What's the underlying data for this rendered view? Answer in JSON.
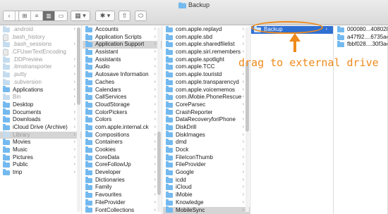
{
  "window": {
    "title": "Backup"
  },
  "toolbar": {
    "back": "‹",
    "forward": "›",
    "view_icons": [
      "⊞",
      "≡",
      "▥",
      "▭"
    ],
    "arrange": "▦ ▾",
    "action": "✱ ▾",
    "share": "⇧",
    "tag": "⬭"
  },
  "columns": [
    {
      "items": [
        {
          "label": ".android",
          "dim": true
        },
        {
          "label": ".bash_history",
          "dim": true,
          "file": true
        },
        {
          "label": ".bash_sessions",
          "dim": true
        },
        {
          "label": ".CFUserTextEncoding",
          "dim": true,
          "file": true
        },
        {
          "label": ".DDPreview",
          "dim": true
        },
        {
          "label": ".itmstransporter",
          "dim": true
        },
        {
          "label": ".putty",
          "dim": true
        },
        {
          "label": ".subversion",
          "dim": true
        },
        {
          "label": "Applications"
        },
        {
          "label": "Bin",
          "dim": true
        },
        {
          "label": "Desktop"
        },
        {
          "label": "Documents"
        },
        {
          "label": "Downloads"
        },
        {
          "label": "iCloud Drive (Archive)"
        },
        {
          "label": "Library",
          "dim": true,
          "selected": true
        },
        {
          "label": "Movies"
        },
        {
          "label": "Music"
        },
        {
          "label": "Pictures"
        },
        {
          "label": "Public"
        },
        {
          "label": "tmp"
        }
      ]
    },
    {
      "items": [
        {
          "label": "Accounts"
        },
        {
          "label": "Application Scripts"
        },
        {
          "label": "Application Support",
          "selected": true
        },
        {
          "label": "Assistant"
        },
        {
          "label": "Assistants"
        },
        {
          "label": "Audio"
        },
        {
          "label": "Autosave Information"
        },
        {
          "label": "Caches"
        },
        {
          "label": "Calendars"
        },
        {
          "label": "CallServices"
        },
        {
          "label": "CloudStorage"
        },
        {
          "label": "ColorPickers"
        },
        {
          "label": "Colors"
        },
        {
          "label": "com.apple.internal.ck"
        },
        {
          "label": "Compositions"
        },
        {
          "label": "Containers"
        },
        {
          "label": "Cookies"
        },
        {
          "label": "CoreData"
        },
        {
          "label": "CoreFollowUp"
        },
        {
          "label": "Developer"
        },
        {
          "label": "Dictionaries"
        },
        {
          "label": "Family"
        },
        {
          "label": "Favourites"
        },
        {
          "label": "FileProvider"
        },
        {
          "label": "FontCollections"
        }
      ]
    },
    {
      "items": [
        {
          "label": "com.apple.replayd"
        },
        {
          "label": "com.apple.sbd"
        },
        {
          "label": "com.apple.sharedfilelist"
        },
        {
          "label": "com.apple.siri.remembers"
        },
        {
          "label": "com.apple.spotlight"
        },
        {
          "label": "com.apple.TCC"
        },
        {
          "label": "com.apple.touristd"
        },
        {
          "label": "com.apple.transparencyd"
        },
        {
          "label": "com.apple.voicememos"
        },
        {
          "label": "com.iMobie.PhoneRescue"
        },
        {
          "label": "CoreParsec"
        },
        {
          "label": "CrashReporter"
        },
        {
          "label": "DataRecoveryforiPhone"
        },
        {
          "label": "DiskDrill"
        },
        {
          "label": "DiskImages"
        },
        {
          "label": "dmd"
        },
        {
          "label": "Dock"
        },
        {
          "label": "FileIconThumb"
        },
        {
          "label": "FileProvider"
        },
        {
          "label": "Google"
        },
        {
          "label": "icdd"
        },
        {
          "label": "iCloud"
        },
        {
          "label": "iMobie"
        },
        {
          "label": "Knowledge"
        },
        {
          "label": "MobileSync",
          "selected": true
        }
      ]
    },
    {
      "items": [
        {
          "label": "Backup",
          "selected_blue": true
        }
      ]
    },
    {
      "items": [
        {
          "label": "000080...40802E"
        },
        {
          "label": "a47f92....6735aed"
        },
        {
          "label": "fbbf028....30f3ae8"
        }
      ]
    }
  ],
  "annotation": {
    "text": "drag to external drive",
    "color": "#ee8a1c"
  },
  "colors": {
    "folder": "#73b9ef",
    "selection_blue": "#2f6fd2",
    "selection_gray": "#d5d5d5",
    "accent": "#ee8a1c"
  }
}
